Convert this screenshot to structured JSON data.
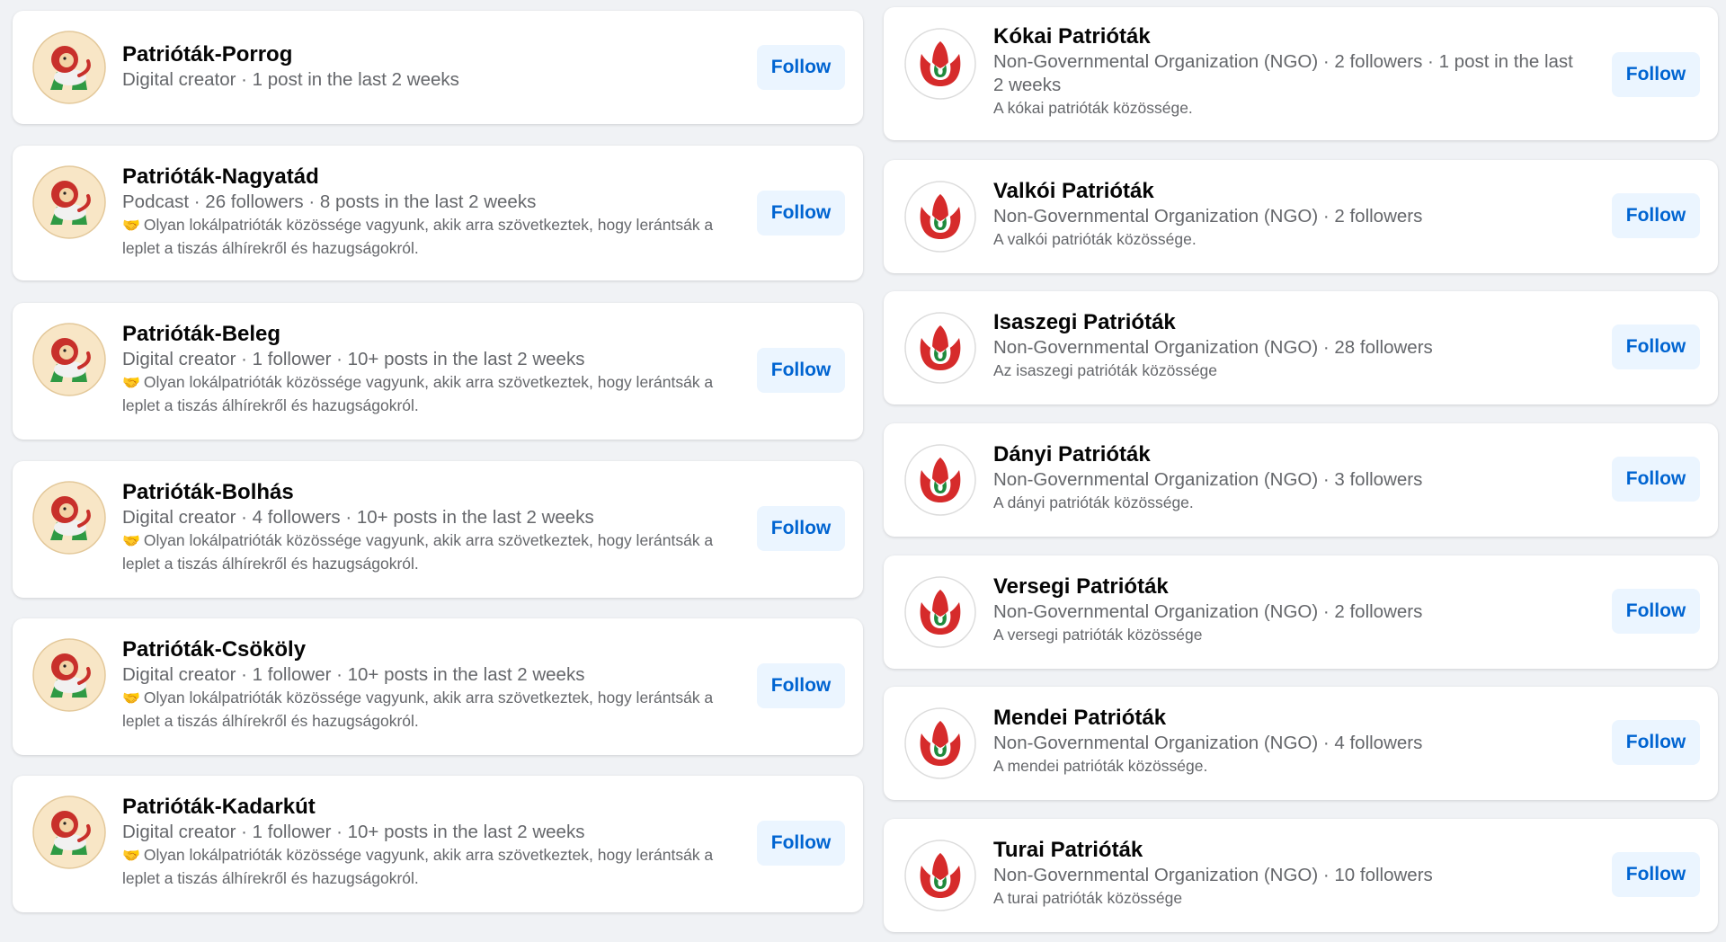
{
  "left_pages": [
    {
      "name": "Patrióták-Porrog",
      "meta": "Digital creator · 1 post in the last 2 weeks",
      "desc": "",
      "follow": "Follow",
      "icon": "lion-avatar-icon"
    },
    {
      "name": "Patrióták-Nagyatád",
      "meta": "Podcast · 26 followers · 8 posts in the last 2 weeks",
      "desc": "Olyan lokálpatrióták közössége vagyunk, akik arra szövetkeztek, hogy lerántsák a leplet a tiszás álhírekről és hazugságokról.",
      "follow": "Follow",
      "icon": "lion-avatar-icon"
    },
    {
      "name": "Patrióták-Beleg",
      "meta": "Digital creator · 1 follower · 10+ posts in the last 2 weeks",
      "desc": "Olyan lokálpatrióták közössége vagyunk, akik arra szövetkeztek, hogy lerántsák a leplet a tiszás álhírekről és hazugságokról.",
      "follow": "Follow",
      "icon": "lion-avatar-icon"
    },
    {
      "name": "Patrióták-Bolhás",
      "meta": "Digital creator · 4 followers · 10+ posts in the last 2 weeks",
      "desc": "Olyan lokálpatrióták közössége vagyunk, akik arra szövetkeztek, hogy lerántsák a leplet a tiszás álhírekről és hazugságokról.",
      "follow": "Follow",
      "icon": "lion-avatar-icon"
    },
    {
      "name": "Patrióták-Csököly",
      "meta": "Digital creator · 1 follower · 10+ posts in the last 2 weeks",
      "desc": "Olyan lokálpatrióták közössége vagyunk, akik arra szövetkeztek, hogy lerántsák a leplet a tiszás álhírekről és hazugságokról.",
      "follow": "Follow",
      "icon": "lion-avatar-icon"
    },
    {
      "name": "Patrióták-Kadarkút",
      "meta": "Digital creator · 1 follower · 10+ posts in the last 2 weeks",
      "desc": "Olyan lokálpatrióták közössége vagyunk, akik arra szövetkeztek, hogy lerántsák a leplet a tiszás álhírekről és hazugságokról.",
      "follow": "Follow",
      "icon": "lion-avatar-icon"
    }
  ],
  "right_pages": [
    {
      "name": "Kókai Patrióták",
      "meta": "Non-Governmental Organization (NGO) · 2 followers · 1 post in the last 2 weeks",
      "desc": "A kókai patrióták közössége.",
      "follow": "Follow",
      "icon": "tulip-logo-icon"
    },
    {
      "name": "Valkói Patrióták",
      "meta": "Non-Governmental Organization (NGO) · 2 followers",
      "desc": "A valkói patrióták közössége.",
      "follow": "Follow",
      "icon": "tulip-logo-icon"
    },
    {
      "name": "Isaszegi Patrióták",
      "meta": "Non-Governmental Organization (NGO) · 28 followers",
      "desc": "Az isaszegi patrióták közössége",
      "follow": "Follow",
      "icon": "tulip-logo-icon"
    },
    {
      "name": "Dányi Patrióták",
      "meta": "Non-Governmental Organization (NGO) · 3 followers",
      "desc": "A dányi patrióták közössége.",
      "follow": "Follow",
      "icon": "tulip-logo-icon"
    },
    {
      "name": "Versegi Patrióták",
      "meta": "Non-Governmental Organization (NGO) · 2 followers",
      "desc": "A versegi patrióták közössége",
      "follow": "Follow",
      "icon": "tulip-logo-icon"
    },
    {
      "name": "Mendei Patrióták",
      "meta": "Non-Governmental Organization (NGO) · 4 followers",
      "desc": "A mendei patrióták közössége.",
      "follow": "Follow",
      "icon": "tulip-logo-icon"
    },
    {
      "name": "Turai Patrióták",
      "meta": "Non-Governmental Organization (NGO) · 10 followers",
      "desc": "A turai patrióták közössége",
      "follow": "Follow",
      "icon": "tulip-logo-icon"
    }
  ],
  "colors": {
    "follow_bg": "#ebf5ff",
    "follow_text": "#0064d1",
    "tulip_red": "#d62b2b",
    "tulip_green": "#1f8a3c",
    "lion_bg": "#f8e6c6"
  },
  "desc_prefix_icon": "handshake-icon"
}
